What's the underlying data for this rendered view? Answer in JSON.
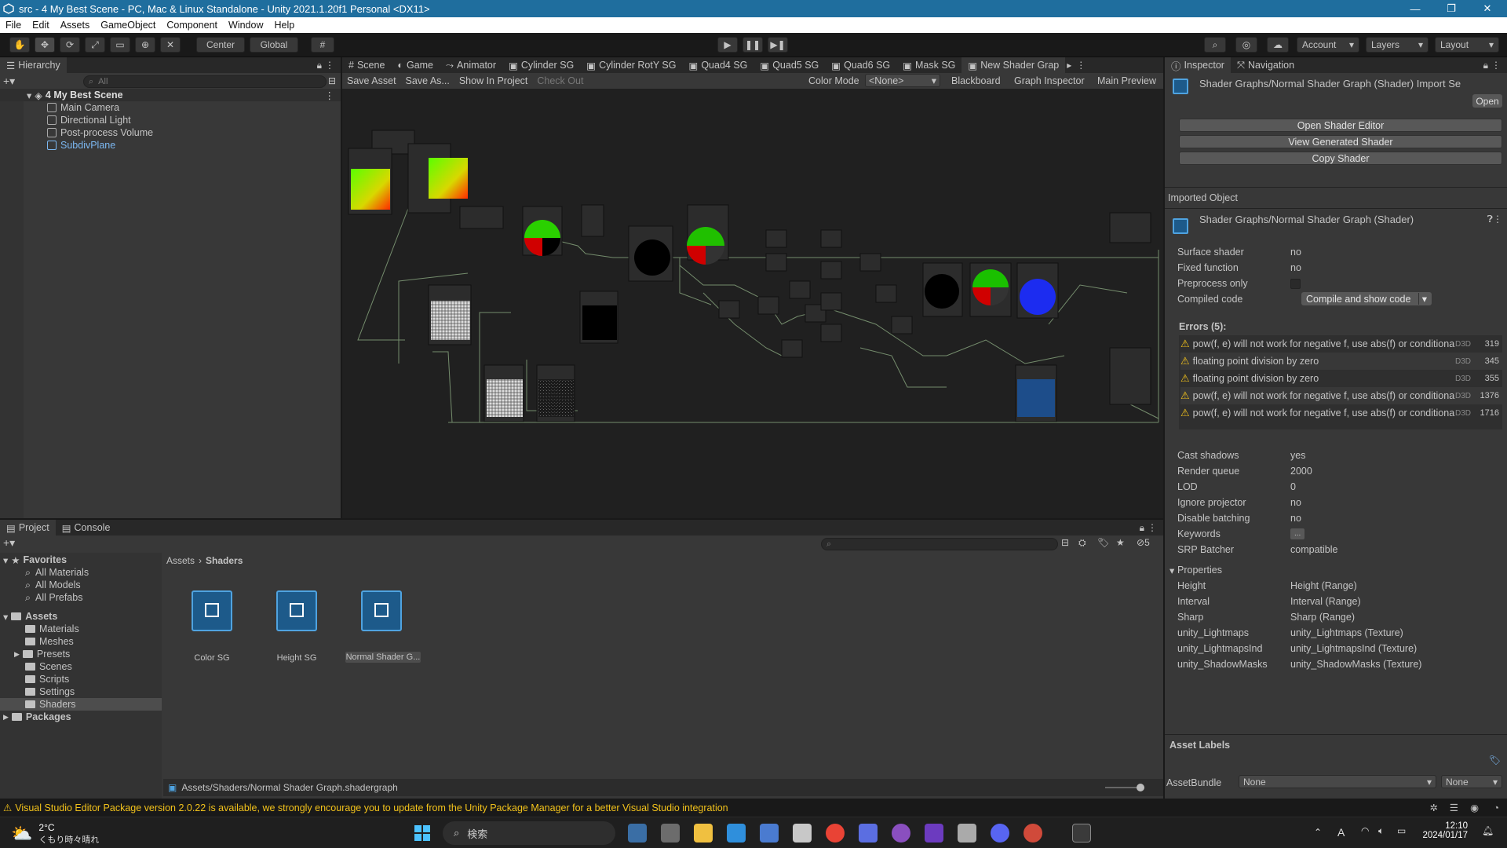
{
  "window": {
    "title": "src - 4 My Best Scene - PC, Mac & Linux Standalone - Unity 2021.1.20f1 Personal <DX11>",
    "minimize": "—",
    "maximize": "❐",
    "close": "✕"
  },
  "menu": [
    "File",
    "Edit",
    "Assets",
    "GameObject",
    "Component",
    "Window",
    "Help"
  ],
  "toolbar": {
    "pivot": "Center",
    "space": "Global",
    "account": "Account",
    "layers": "Layers",
    "layout": "Layout"
  },
  "hierarchy": {
    "tab": "Hierarchy",
    "search_placeholder": "All",
    "scene": "4 My Best Scene",
    "items": [
      "Main Camera",
      "Directional Light",
      "Post-process Volume",
      "SubdivPlane"
    ]
  },
  "editor_tabs": [
    "Scene",
    "Game",
    "Animator",
    "Cylinder SG",
    "Cylinder RotY SG",
    "Quad4 SG",
    "Quad5 SG",
    "Quad6 SG",
    "Mask SG",
    "New Shader Grap"
  ],
  "graph_toolbar": {
    "save": "Save Asset",
    "save_as": "Save As...",
    "show": "Show In Project",
    "checkout": "Check Out",
    "color_mode_label": "Color Mode",
    "color_mode_value": "<None>",
    "blackboard": "Blackboard",
    "graph_inspector": "Graph Inspector",
    "main_preview": "Main Preview"
  },
  "inspector": {
    "tab": "Inspector",
    "nav_tab": "Navigation",
    "header": "Shader Graphs/Normal Shader Graph (Shader) Import Se",
    "open": "Open",
    "buttons": [
      "Open Shader Editor",
      "View Generated Shader",
      "Copy Shader"
    ],
    "imported_object": "Imported Object",
    "shader_name": "Shader Graphs/Normal Shader Graph (Shader)",
    "props1": [
      {
        "k": "Surface shader",
        "v": "no"
      },
      {
        "k": "Fixed function",
        "v": "no"
      },
      {
        "k": "Preprocess only",
        "v": ""
      },
      {
        "k": "Compiled code",
        "v": "Compile and show code"
      }
    ],
    "errors_title": "Errors (5):",
    "errors": [
      {
        "msg": "pow(f, e) will not work for negative f, use abs(f) or conditiona",
        "api": "D3D",
        "line": "319"
      },
      {
        "msg": "floating point division by zero",
        "api": "D3D",
        "line": "345"
      },
      {
        "msg": "floating point division by zero",
        "api": "D3D",
        "line": "355"
      },
      {
        "msg": "pow(f, e) will not work for negative f, use abs(f) or conditiona",
        "api": "D3D",
        "line": "1376"
      },
      {
        "msg": "pow(f, e) will not work for negative f, use abs(f) or conditiona",
        "api": "D3D",
        "line": "1716"
      }
    ],
    "props2": [
      {
        "k": "Cast shadows",
        "v": "yes"
      },
      {
        "k": "Render queue",
        "v": "2000"
      },
      {
        "k": "LOD",
        "v": "0"
      },
      {
        "k": "Ignore projector",
        "v": "no"
      },
      {
        "k": "Disable batching",
        "v": "no"
      },
      {
        "k": "Keywords",
        "v": "..."
      },
      {
        "k": "SRP Batcher",
        "v": "compatible"
      }
    ],
    "properties_title": "Properties",
    "properties": [
      {
        "k": "Height",
        "v": "Height (Range)"
      },
      {
        "k": "Interval",
        "v": "Interval (Range)"
      },
      {
        "k": "Sharp",
        "v": "Sharp (Range)"
      },
      {
        "k": "unity_Lightmaps",
        "v": "unity_Lightmaps (Texture)"
      },
      {
        "k": "unity_LightmapsInd",
        "v": "unity_LightmapsInd (Texture)"
      },
      {
        "k": "unity_ShadowMasks",
        "v": "unity_ShadowMasks (Texture)"
      }
    ],
    "asset_labels": "Asset Labels",
    "assetbundle_label": "AssetBundle",
    "assetbundle_value": "None",
    "assetbundle_variant": "None"
  },
  "project": {
    "tab": "Project",
    "console_tab": "Console",
    "hidden_count": "5",
    "favorites": "Favorites",
    "fav_items": [
      "All Materials",
      "All Models",
      "All Prefabs"
    ],
    "assets": "Assets",
    "asset_folders": [
      "Materials",
      "Meshes",
      "Presets",
      "Scenes",
      "Scripts",
      "Settings",
      "Shaders"
    ],
    "packages": "Packages",
    "breadcrumb": [
      "Assets",
      "Shaders"
    ],
    "files": [
      "Color SG",
      "Height SG",
      "Normal Shader G..."
    ],
    "path": "Assets/Shaders/Normal Shader Graph.shadergraph"
  },
  "status": "Visual Studio Editor Package version 2.0.22 is available, we strongly encourage you to update from the Unity Package Manager for a better Visual Studio integration",
  "taskbar": {
    "temp": "2°C",
    "weather": "くもり時々晴れ",
    "search": "検索",
    "time": "12:10",
    "date": "2024/01/17",
    "ime": "A"
  }
}
